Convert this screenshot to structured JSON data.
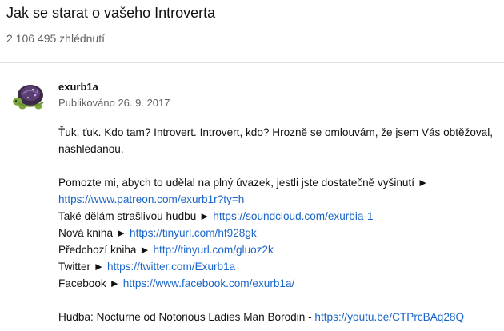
{
  "video": {
    "title": "Jak se starat o vašeho Introverta",
    "views": "2 106 495 zhlédnutí"
  },
  "channel": {
    "name": "exurb1a",
    "avatar_icon": "turtle-avatar-icon",
    "published": "Publikováno 26. 9. 2017"
  },
  "description": {
    "intro_line1": "Ťuk, ťuk. Kdo tam? Introvert. Introvert, kdo? Hrozně se omlouvám, že jsem Vás obtěžoval,",
    "intro_line2": "nashledanou.",
    "links": [
      {
        "label": "Pomozte mi, abych to udělal na plný úvazek, jestli jste dostatečně vyšinutí ►",
        "url": "https://www.patreon.com/exurb1r?ty=h",
        "same_line": false
      },
      {
        "label": "Také dělám strašlivou hudbu ►",
        "url": "https://soundcloud.com/exurbia-1",
        "same_line": true
      },
      {
        "label": "Nová kniha ►",
        "url": "https://tinyurl.com/hf928gk",
        "same_line": true
      },
      {
        "label": "Předchozí kniha ►",
        "url": "http://tinyurl.com/gluoz2k",
        "same_line": true
      },
      {
        "label": "Twitter ►",
        "url": "https://twitter.com/Exurb1a",
        "same_line": true
      },
      {
        "label": "Facebook ►",
        "url": "https://www.facebook.com/exurb1a/",
        "same_line": true
      }
    ],
    "music": {
      "label": "Hudba: Nocturne od Notorious Ladies Man Borodin -",
      "url": "https://youtu.be/CTPrcBAq28Q"
    }
  },
  "colors": {
    "link": "#1a65c9",
    "secondary_text": "#606060"
  }
}
